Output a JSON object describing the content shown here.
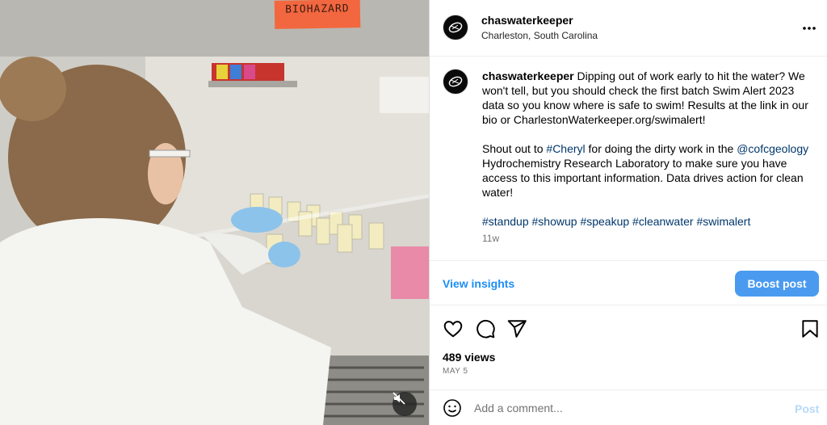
{
  "media": {
    "sign_text": "BIOHAZARD"
  },
  "header": {
    "username": "chaswaterkeeper",
    "location": "Charleston, South Carolina"
  },
  "caption": {
    "username": "chaswaterkeeper",
    "p1": "Dipping out of work early to hit the water? We won't tell, but you should check the first batch Swim Alert 2023 data so you know where is safe to swim! Results at the link in our bio or CharlestonWaterkeeper.org/swimalert!",
    "p2_prefix": "Shout out to ",
    "p2_tag1": "#Cheryl",
    "p2_mid": " for doing the dirty work in the ",
    "p2_tag2": "@cofcgeology",
    "p2_suffix": " Hydrochemistry Research Laboratory to make sure you have access to this important information. Data drives action for clean water!",
    "hashtags": [
      "#standup",
      "#showup",
      "#speakup",
      "#cleanwater",
      "#swimalert"
    ],
    "time_ago": "11w"
  },
  "insights": {
    "view_label": "View insights",
    "boost_label": "Boost post"
  },
  "stats": {
    "views": "489 views",
    "date": "MAY 5"
  },
  "comment": {
    "placeholder": "Add a comment...",
    "post_label": "Post"
  }
}
